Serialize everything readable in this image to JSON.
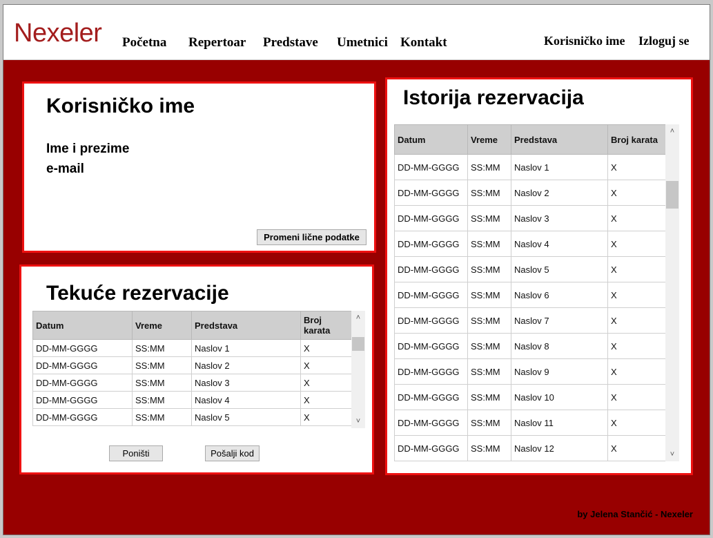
{
  "header": {
    "logo": "Nexeler",
    "nav": [
      "Početna",
      "Repertoar",
      "Predstave",
      "Umetnici",
      "Kontakt"
    ],
    "user": "Korisničko ime",
    "logout": "Izloguj se"
  },
  "profile": {
    "title": "Korisničko ime",
    "fullname_label": "Ime i prezime",
    "email_label": "e-mail",
    "edit_button": "Promeni lične podatke"
  },
  "current": {
    "title": "Tekuće rezervacije",
    "columns": [
      "Datum",
      "Vreme",
      "Predstava",
      "Broj karata"
    ],
    "rows": [
      [
        "DD-MM-GGGG",
        "SS:MM",
        "Naslov 1",
        "X"
      ],
      [
        "DD-MM-GGGG",
        "SS:MM",
        "Naslov 2",
        "X"
      ],
      [
        "DD-MM-GGGG",
        "SS:MM",
        "Naslov 3",
        "X"
      ],
      [
        "DD-MM-GGGG",
        "SS:MM",
        "Naslov 4",
        "X"
      ],
      [
        "DD-MM-GGGG",
        "SS:MM",
        "Naslov 5",
        "X"
      ]
    ],
    "cancel_button": "Poništi",
    "send_button": "Pošalji kod"
  },
  "history": {
    "title": "Istorija rezervacija",
    "columns": [
      "Datum",
      "Vreme",
      "Predstava",
      "Broj karata"
    ],
    "rows": [
      [
        "DD-MM-GGGG",
        "SS:MM",
        "Naslov 1",
        "X"
      ],
      [
        "DD-MM-GGGG",
        "SS:MM",
        "Naslov 2",
        "X"
      ],
      [
        "DD-MM-GGGG",
        "SS:MM",
        "Naslov 3",
        "X"
      ],
      [
        "DD-MM-GGGG",
        "SS:MM",
        "Naslov 4",
        "X"
      ],
      [
        "DD-MM-GGGG",
        "SS:MM",
        "Naslov 5",
        "X"
      ],
      [
        "DD-MM-GGGG",
        "SS:MM",
        "Naslov 6",
        "X"
      ],
      [
        "DD-MM-GGGG",
        "SS:MM",
        "Naslov 7",
        "X"
      ],
      [
        "DD-MM-GGGG",
        "SS:MM",
        "Naslov 8",
        "X"
      ],
      [
        "DD-MM-GGGG",
        "SS:MM",
        "Naslov 9",
        "X"
      ],
      [
        "DD-MM-GGGG",
        "SS:MM",
        "Naslov 10",
        "X"
      ],
      [
        "DD-MM-GGGG",
        "SS:MM",
        "Naslov 11",
        "X"
      ],
      [
        "DD-MM-GGGG",
        "SS:MM",
        "Naslov 12",
        "X"
      ]
    ]
  },
  "icons": {
    "scroll_up": "chevron-up-icon",
    "scroll_down": "chevron-down-icon"
  },
  "footer": "by Jelena Stančić - Nexeler",
  "colors": {
    "background": "#980000",
    "panel_border": "#ee1111",
    "logo": "#a31d1d",
    "table_header": "#cfcfcf"
  }
}
